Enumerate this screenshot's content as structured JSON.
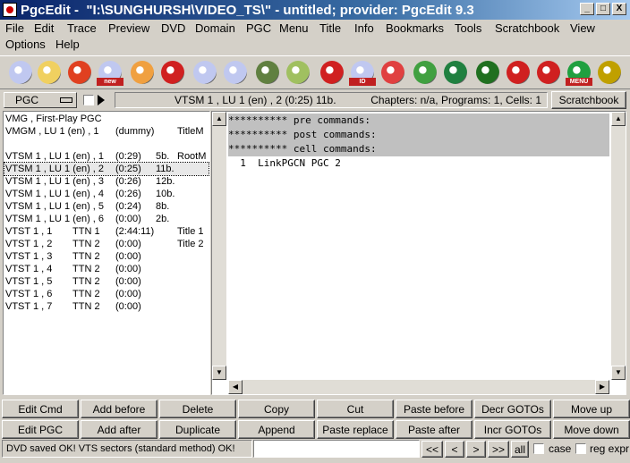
{
  "window": {
    "title": "PgcEdit -  \"I:\\SUNGHURSH\\VIDEO_TS\\\" - untitled; provider: PgcEdit 9.3",
    "minimize": "_",
    "maximize": "□",
    "close": "X"
  },
  "menu": {
    "row1": [
      "File",
      "Edit",
      "Trace",
      "Preview",
      "DVD",
      "Domain",
      "PGC",
      "Menu",
      "Title",
      "Info",
      "Bookmarks",
      "Tools",
      "Scratchbook",
      "View"
    ],
    "row2": [
      "Options",
      "Help"
    ]
  },
  "toolbar": {
    "icons": [
      {
        "name": "dvd-open-icon",
        "color": "#c0c8f0"
      },
      {
        "name": "folder-open-icon",
        "color": "#f0d060"
      },
      {
        "name": "reload-icon",
        "color": "#e04020"
      },
      {
        "name": "new-dvd-icon",
        "color": "#c0c8f0",
        "label": "new"
      },
      {
        "name": "rocket-icon",
        "color": "#f0a040"
      },
      {
        "name": "search-icon",
        "color": "#d02020"
      },
      {
        "name": "trace-discs-icon",
        "color": "#c0c8f0"
      },
      {
        "name": "cursor-discs-icon",
        "color": "#c0c8f0"
      },
      {
        "name": "pen-icon",
        "color": "#608040"
      },
      {
        "name": "edit-doc-icon",
        "color": "#a0c060"
      },
      {
        "name": "check-disc-icon",
        "color": "#d02020"
      },
      {
        "name": "id-disc-icon",
        "color": "#c0c8f0",
        "label": "ID"
      },
      {
        "name": "doc-icon",
        "color": "#e04040"
      },
      {
        "name": "globe-icon",
        "color": "#40a040"
      },
      {
        "name": "player-icon",
        "color": "#208040"
      },
      {
        "name": "film-reel-icon",
        "color": "#207020"
      },
      {
        "name": "list-check-icon",
        "color": "#d02020"
      },
      {
        "name": "cross-list-icon",
        "color": "#d02020"
      },
      {
        "name": "menu-icon",
        "color": "#20a040",
        "label": "MENU"
      },
      {
        "name": "chain-icon",
        "color": "#c0a000"
      }
    ]
  },
  "selector": {
    "domain_value": "PGC",
    "info_left": "VTSM 1 , LU 1 (en) , 2  (0:25)  11b.",
    "info_right": "Chapters: n/a,  Programs: 1,  Cells: 1",
    "scratchbook_label": "Scratchbook"
  },
  "pgc_list": [
    {
      "a": "VMG , First-Play PGC",
      "b": "",
      "c": "",
      "d": "",
      "e": ""
    },
    {
      "a": "VMGM , LU 1 (en) , 1",
      "b": "",
      "c": "(dummy)",
      "d": "",
      "e": "TitleM"
    },
    {
      "a": "",
      "b": "",
      "c": "",
      "d": "",
      "e": ""
    },
    {
      "a": "VTSM 1 , LU 1 (en) , 1",
      "b": "",
      "c": "(0:29)",
      "d": "5b.",
      "e": "RootM"
    },
    {
      "a": "VTSM 1 , LU 1 (en) , 2",
      "b": "",
      "c": "(0:25)",
      "d": "11b.",
      "e": "",
      "selected": true
    },
    {
      "a": "VTSM 1 , LU 1 (en) , 3",
      "b": "",
      "c": "(0:26)",
      "d": "12b.",
      "e": ""
    },
    {
      "a": "VTSM 1 , LU 1 (en) , 4",
      "b": "",
      "c": "(0:26)",
      "d": "10b.",
      "e": ""
    },
    {
      "a": "VTSM 1 , LU 1 (en) , 5",
      "b": "",
      "c": "(0:24)",
      "d": "8b.",
      "e": ""
    },
    {
      "a": "VTSM 1 , LU 1 (en) , 6",
      "b": "",
      "c": "(0:00)",
      "d": "2b.",
      "e": ""
    },
    {
      "a": "VTST 1 , 1",
      "b": "TTN 1",
      "c": "(2:44:11)",
      "d": "",
      "e": "Title 1"
    },
    {
      "a": "VTST 1 , 2",
      "b": "TTN 2",
      "c": "(0:00)",
      "d": "",
      "e": "Title 2"
    },
    {
      "a": "VTST 1 , 3",
      "b": "TTN 2",
      "c": "(0:00)",
      "d": "",
      "e": ""
    },
    {
      "a": "VTST 1 , 4",
      "b": "TTN 2",
      "c": "(0:00)",
      "d": "",
      "e": ""
    },
    {
      "a": "VTST 1 , 5",
      "b": "TTN 2",
      "c": "(0:00)",
      "d": "",
      "e": ""
    },
    {
      "a": "VTST 1 , 6",
      "b": "TTN 2",
      "c": "(0:00)",
      "d": "",
      "e": ""
    },
    {
      "a": "VTST 1 , 7",
      "b": "TTN 2",
      "c": "(0:00)",
      "d": "",
      "e": ""
    }
  ],
  "commands": {
    "pre": "********** pre commands:",
    "post": "********** post commands:",
    "cell": "********** cell commands:",
    "lines": [
      "  1  LinkPGCN PGC 2"
    ]
  },
  "buttons": {
    "row1": [
      "Edit Cmd",
      "Add before",
      "Delete",
      "Copy",
      "Cut",
      "Paste before",
      "Decr GOTOs",
      "Move up"
    ],
    "row2": [
      "Edit PGC",
      "Add after",
      "Duplicate",
      "Append",
      "Paste replace",
      "Paste after",
      "Incr GOTOs",
      "Move down"
    ]
  },
  "statusbar": {
    "message": "DVD saved OK!  VTS sectors (standard method) OK!",
    "find_value": "",
    "nav": [
      "<<",
      "<",
      ">",
      ">>",
      "all"
    ],
    "case_label": "case",
    "regexpr_label": "reg expr"
  }
}
